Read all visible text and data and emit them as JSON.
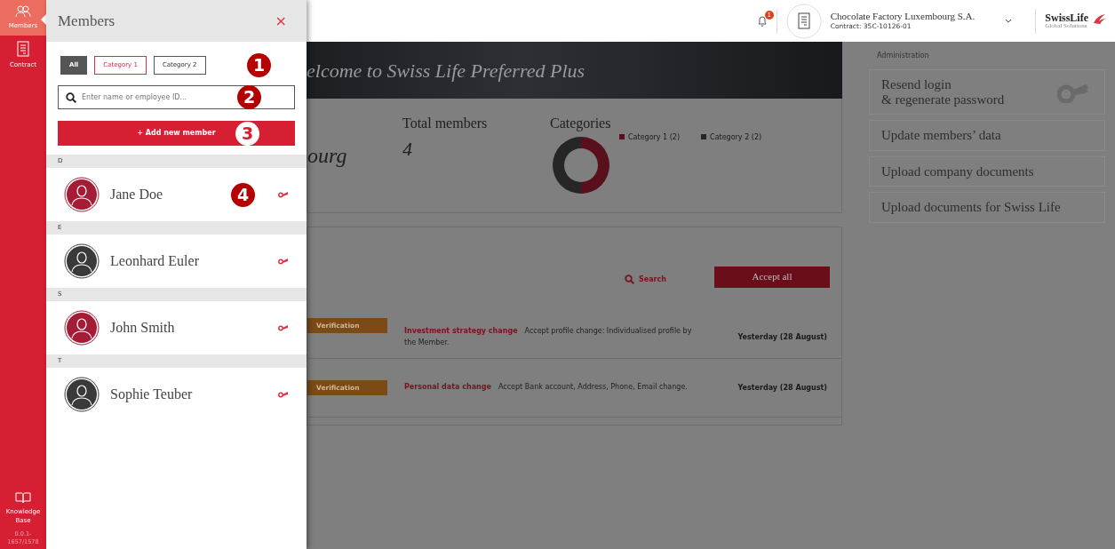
{
  "rail": {
    "items": [
      {
        "label": "Members",
        "selected": true
      },
      {
        "label": "Contract",
        "selected": false
      }
    ],
    "bottom_item": {
      "label": "Knowledge Base"
    },
    "version": "0.0.1-1657/1578"
  },
  "drawer": {
    "title": "Members",
    "close": "×",
    "filters": [
      {
        "label": "All",
        "selected": true
      },
      {
        "label": "Category 1",
        "selected": false,
        "color": "#c8324a"
      },
      {
        "label": "Category 2",
        "selected": false,
        "color": "#555555"
      }
    ],
    "filters_callout": "1",
    "search": {
      "placeholder": "Enter name or employee ID...",
      "callout": "2"
    },
    "add_button": {
      "label": "+ Add new member",
      "callout": "3"
    },
    "groups": [
      {
        "letter": "D",
        "members": [
          {
            "name": "Jane Doe",
            "color": "#a51c36",
            "callout": "4"
          }
        ]
      },
      {
        "letter": "E",
        "members": [
          {
            "name": "Leonhard Euler",
            "color": "#3a3a3a"
          }
        ]
      },
      {
        "letter": "S",
        "members": [
          {
            "name": "John Smith",
            "color": "#a51c36"
          }
        ]
      },
      {
        "letter": "T",
        "members": [
          {
            "name": "Sophie Teuber",
            "color": "#3a3a3a"
          }
        ]
      }
    ]
  },
  "header": {
    "notifications": "1",
    "company": "Chocolate Factory Luxembourg S.A.",
    "contract": "Contract: 35C-10126-01",
    "logo": {
      "name": "SwissLife",
      "subtitle": "Global Solutions"
    }
  },
  "banner": {
    "title": "elcome to Swiss Life Preferred Plus"
  },
  "stats": {
    "company_fragment": "ourg",
    "total_label": "Total members",
    "total_value": "4",
    "categories_label": "Categories",
    "chart_data": {
      "type": "donut",
      "categories": [
        "Category 1 (2)",
        "Category 2 (2)"
      ],
      "series": [
        {
          "values": [
            2,
            2
          ]
        }
      ],
      "colors": [
        "#5a0f1c",
        "#262626"
      ]
    }
  },
  "tasks": {
    "search": "Search",
    "accept_all": "Accept all",
    "rows": [
      {
        "status": "Verification",
        "title": "Investment strategy change",
        "description": "Accept profile change: Individualised profile by the Member.",
        "date": "Yesterday (28 August)"
      },
      {
        "status": "Verification",
        "title": "Personal data change",
        "description": "Accept Bank account, Address, Phone, Email change.",
        "date": "Yesterday (28 August)"
      }
    ]
  },
  "administration": {
    "heading": "Administration",
    "actions": [
      {
        "label": "Resend login\n& regenerate password"
      },
      {
        "label": "Update members’ data"
      },
      {
        "label": "Upload company documents"
      },
      {
        "label": "Upload documents for Swiss Life"
      }
    ]
  }
}
